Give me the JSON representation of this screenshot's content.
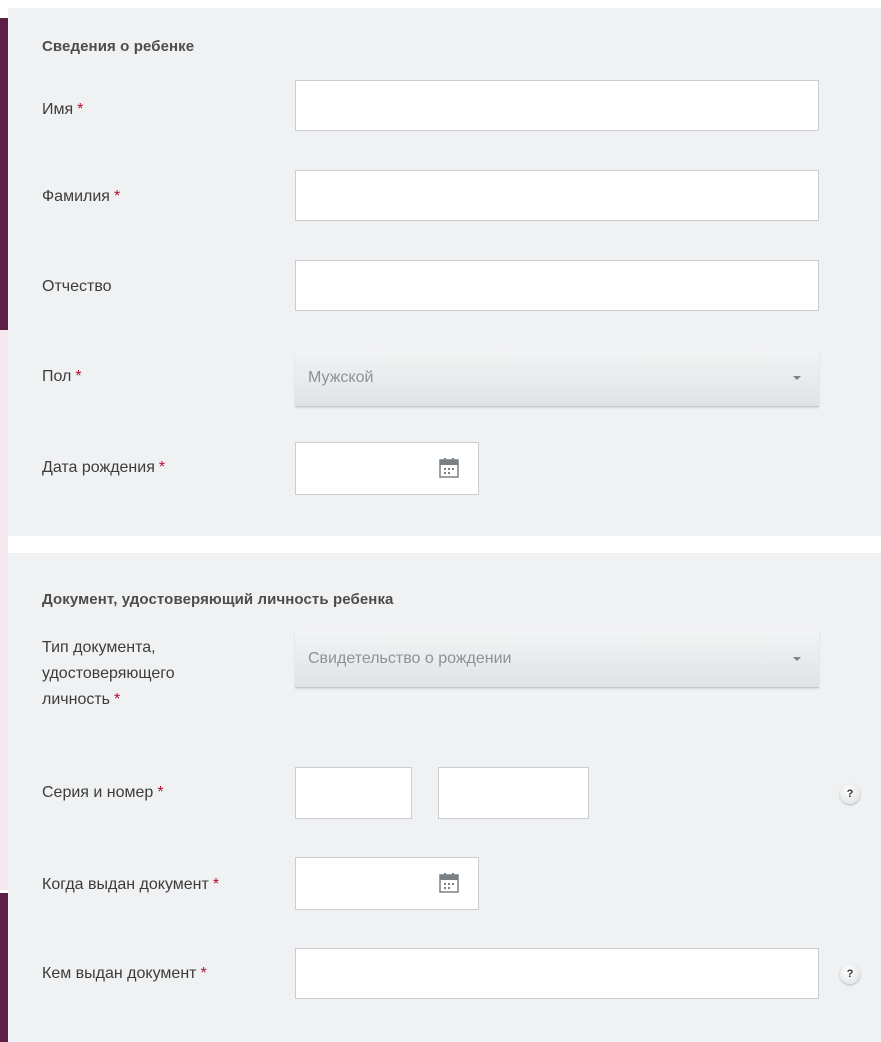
{
  "child_section": {
    "title": "Сведения о ребенке",
    "first_name": {
      "label": "Имя",
      "required_mark": "*",
      "value": ""
    },
    "last_name": {
      "label": "Фамилия",
      "required_mark": "*",
      "value": ""
    },
    "patronymic": {
      "label": "Отчество",
      "value": ""
    },
    "gender": {
      "label": "Пол",
      "required_mark": "*",
      "selected": "Мужской"
    },
    "birth_date": {
      "label": "Дата рождения",
      "required_mark": "*",
      "value": ""
    }
  },
  "document_section": {
    "title": "Документ, удостоверяющий личность ребенка",
    "doc_type": {
      "label_line1": "Тип документа,",
      "label_line2": "удостоверяющего",
      "label_line3": "личность",
      "required_mark": "*",
      "selected": "Свидетельство о рождении"
    },
    "series_number": {
      "label": "Серия и номер",
      "required_mark": "*",
      "series": "",
      "number": "",
      "help": "?"
    },
    "issue_date": {
      "label": "Когда выдан документ",
      "required_mark": "*",
      "value": ""
    },
    "issued_by": {
      "label": "Кем выдан документ",
      "required_mark": "*",
      "value": "",
      "help": "?"
    }
  },
  "colors": {
    "accent_strip": "#5e1f47",
    "required": "#b0112f",
    "panel_bg": "#eff1f3"
  },
  "icons": {
    "calendar": "calendar-icon",
    "dropdown": "chevron-down-icon",
    "help": "help-icon"
  }
}
